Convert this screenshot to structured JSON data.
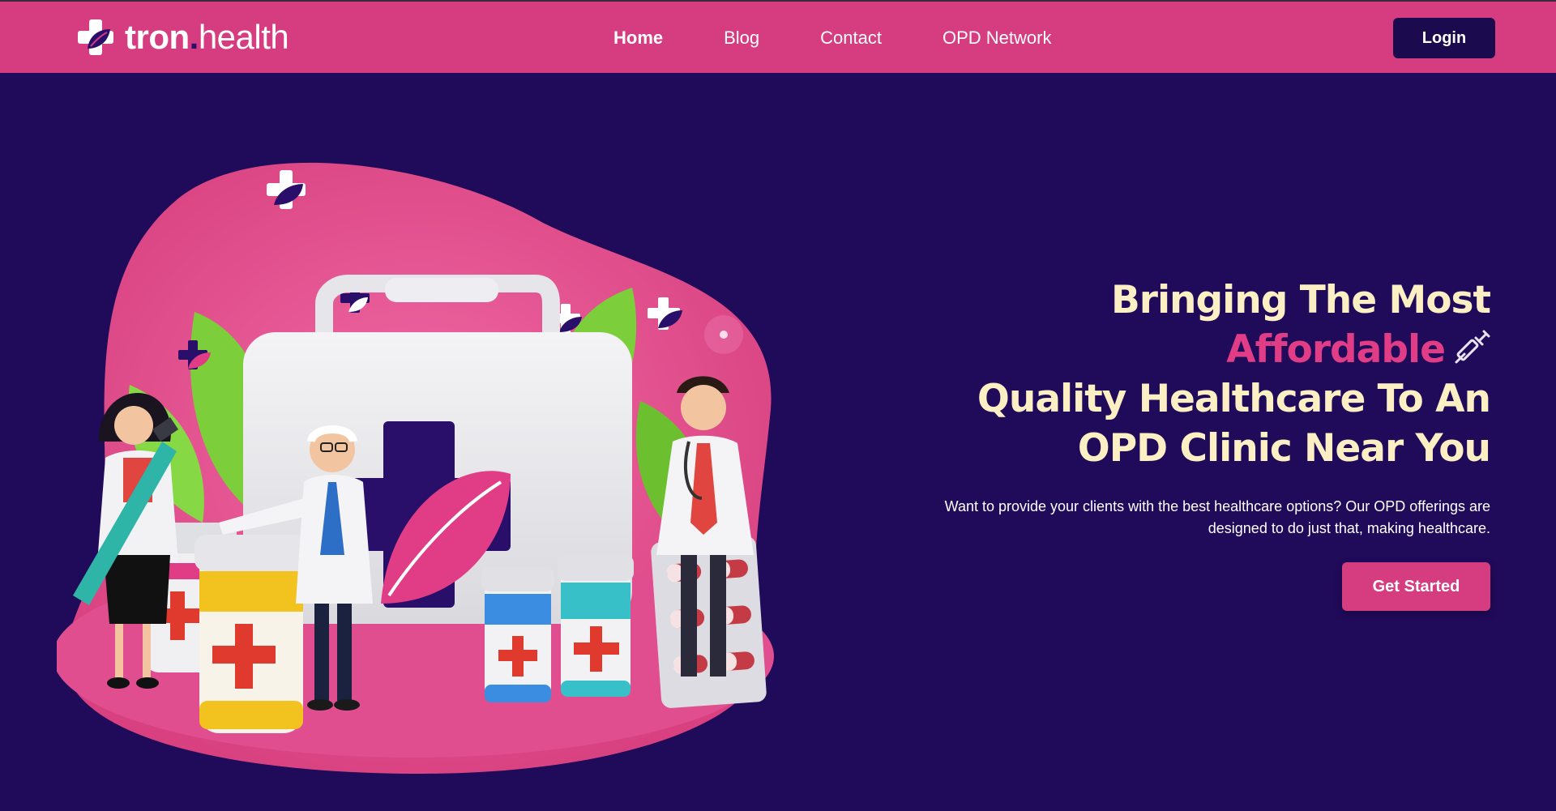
{
  "brand": {
    "name_bold": "tron",
    "name_dot": ".",
    "name_light": "health"
  },
  "nav": {
    "items": [
      {
        "label": "Home",
        "active": true
      },
      {
        "label": "Blog",
        "active": false
      },
      {
        "label": "Contact",
        "active": false
      },
      {
        "label": "OPD Network",
        "active": false
      }
    ],
    "login_label": "Login"
  },
  "hero": {
    "line1": "Bringing The Most",
    "line2_accent": "Affordable",
    "line3": "Quality Healthcare To An",
    "line4": "OPD Clinic Near You",
    "subtext_line1": "Want to provide your clients with the best healthcare options? Our OPD offerings are",
    "subtext_line2": "designed to do just that, making healthcare.",
    "cta_label": "Get Started",
    "illustration_icon": "medical-kit-doctors-illustration",
    "syringe_icon": "syringe-icon"
  },
  "colors": {
    "background": "#200a5a",
    "navbar": "#d63c80",
    "accent_pink": "#e13d86",
    "headline_cream": "#fcefc4",
    "login_button": "#1c0a4e"
  }
}
